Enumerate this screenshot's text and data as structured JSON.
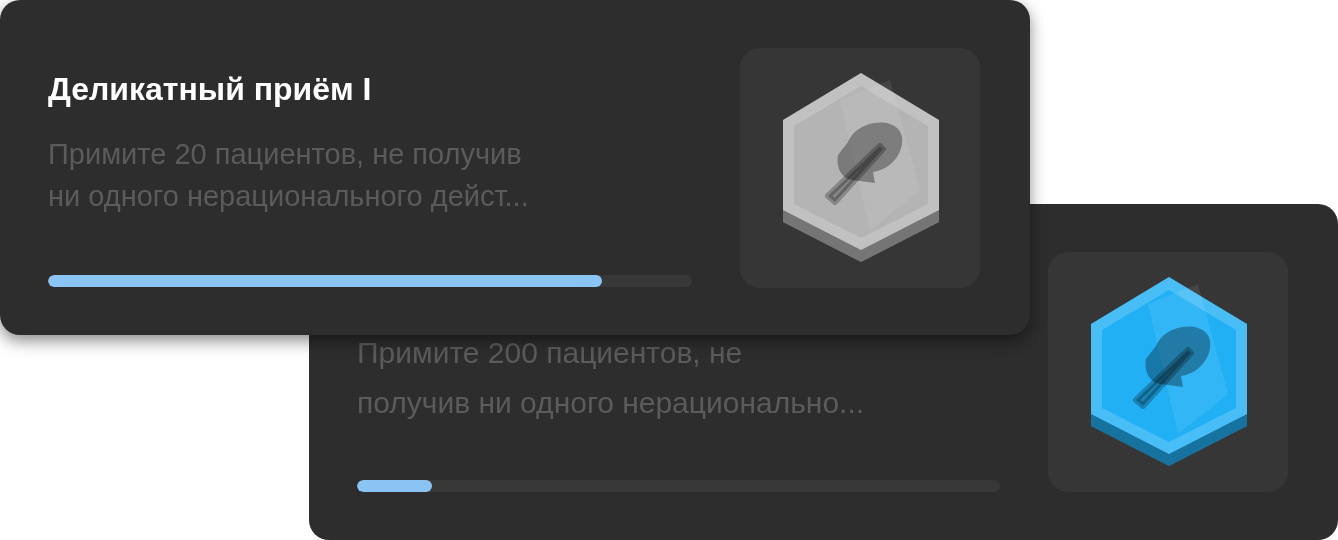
{
  "cards": [
    {
      "title": "Деликатный приём I",
      "description": "Примите 20 пациентов, не получив\nни одного нерационального дейст...",
      "level": 0.86,
      "color": "#b4b4b4"
    },
    {
      "description": "Примите 200 пациентов, не\nполучив ни одного нерационально...",
      "level": 0.117,
      "color": "#22b0f5"
    }
  ]
}
